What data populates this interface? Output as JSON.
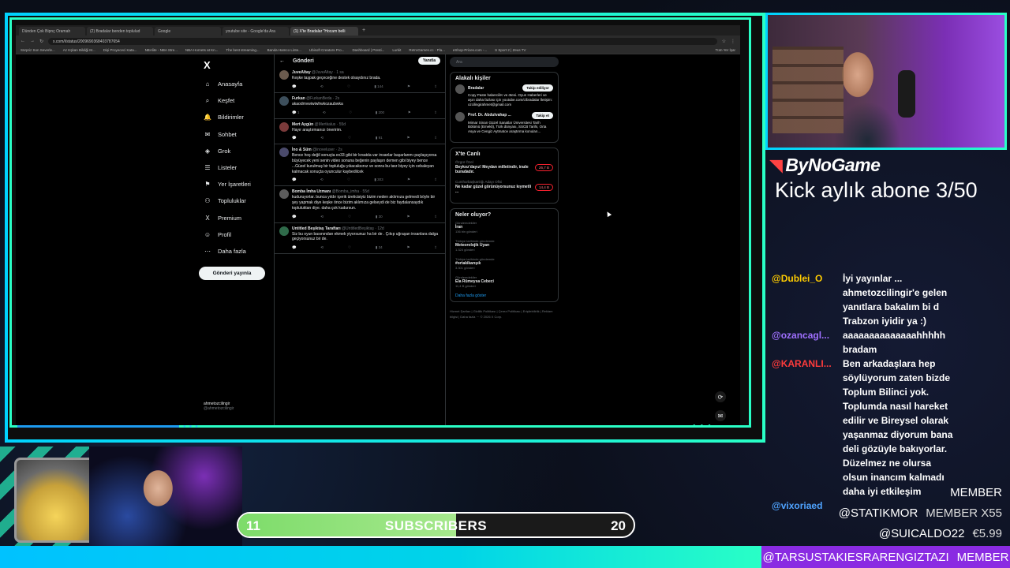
{
  "browser": {
    "tabs": [
      "Dünden Çok Bipnç Oramah",
      "(2) Bradalar benden toplulud",
      "Google",
      "youtube site - Google'da Ara",
      "(1) X'te Bradalar \"Hocam belli"
    ],
    "tab_new": "+",
    "url": "x.com/i/status/2009690368403787654",
    "bookmarks": [
      "Sürpriz Son Severle...",
      "Az Kşkan Bildiği M...",
      "Dişi Proyececi Kata...",
      "NBAlite - NBA Stre...",
      "NBA Hornets at Kn...",
      "The best streaming...",
      "Banda Hamco Linte...",
      "Ubisoft Creators Pro...",
      "Dashboard | Presti...",
      "Lurkit",
      "RetroGames.cc - Pla...",
      "eShop-Prices.com -...",
      "S Sport 2 | Zeus TV"
    ],
    "bookmarks_right": "Tüm Yer İşar"
  },
  "x": {
    "logo": "X",
    "nav": [
      {
        "icon": "⌂",
        "label": "Anasayfa"
      },
      {
        "icon": "⌕",
        "label": "Keşfet"
      },
      {
        "icon": "🔔",
        "label": "Bildirimler"
      },
      {
        "icon": "✉",
        "label": "Sohbet"
      },
      {
        "icon": "◈",
        "label": "Grok"
      },
      {
        "icon": "☰",
        "label": "Listeler"
      },
      {
        "icon": "⚑",
        "label": "Yer İşaretleri"
      },
      {
        "icon": "⚇",
        "label": "Topluluklar"
      },
      {
        "icon": "X",
        "label": "Premium"
      },
      {
        "icon": "☺",
        "label": "Profil"
      },
      {
        "icon": "⋯",
        "label": "Daha fazla"
      }
    ],
    "post_button": "Gönderi yayınla",
    "account": {
      "name": "ahmetozcilingir",
      "handle": "@ahmetozcilingir"
    },
    "header": {
      "back": "←",
      "title": "Gönderi",
      "reply": "Yanıtla"
    },
    "tweets": [
      {
        "name": "JuveAltay",
        "meta": "@JuveAltay · 1 sa",
        "text": "Keşke taşpak geçeceğine destek olsaydınız brada.",
        "stats": [
          "",
          "",
          "",
          "144"
        ]
      },
      {
        "name": "Furkan",
        "meta": "@FurkanBeda · 2s",
        "text": "akaodmvwiwiwhwkozaubwka",
        "stats": [
          "1",
          "",
          "",
          "200"
        ]
      },
      {
        "name": "Mert Aygün",
        "meta": "@Mertkalus · 55d",
        "text": "Hayır araştırmanızı öneririm.",
        "stats": [
          "",
          "",
          "",
          "91"
        ]
      },
      {
        "name": "İno & Süm",
        "meta": "@inoveluser · 2s",
        "text": "Bence hoş değil sonuçta ex33 gibi bir krsatda var insanlar başarlanmı paylaşıyorsa büyüyecek yeni senin video sonuna beğenin paylaşın demen gibi biyey bence ...Güzel kurulmuş bir topluluğu yıkacaksınız ve sonra bu tarz biyey için cebaleyan kalmacak sonuçta oyunculur kaybedilcek",
        "stats": [
          "",
          "",
          "",
          "303"
        ]
      },
      {
        "name": "Bomba İmha Uzmanı",
        "meta": "@Bomba_imha · 55d",
        "text": "kuduruyorlar. bunca yıldır içerik üreticisiyiz bizim neden aklımıza gelmedi böyle bir şey yapmak diye keşke önce bizim aklımıza gelseydi de biz faydalansaydık topluluktan diye. daha çok kudursun.",
        "stats": [
          "",
          "",
          "",
          "30"
        ]
      },
      {
        "name": "Untitled Beşiktaş Taraftarı",
        "meta": "@UntitledBeşiktaş · 12d",
        "text": "Siz bu oyun basınından ekmek yiyorsunuz ha bir de . Çıkıp uğraşan insanlara dalga geçiyorsunuz bir de.",
        "stats": [
          "",
          "",
          "",
          "34"
        ]
      }
    ],
    "search_placeholder": "Ara",
    "related": {
      "title": "Alakalı kişiler",
      "people": [
        {
          "name": "Bradalar",
          "bio": "Copy Paste haberciliK ve ötesi. Oyun Haberleri ve aşırı daha fazlası için youtube.com/c/bradalar İletişim: ozcilingirahmet@gmail.com",
          "button": "Takip ediliyor"
        },
        {
          "name": "Prof. Dr. Abdulvahap ...",
          "bio": "Mimar Sinan Güzel Sanatlar Üniversitesi Tarih Bölümü (Emekli), Türk dünyası, SSCB Tarihi, Orta Asya ve Cengiz Aytmatov araştırma konuları...",
          "button": "Takip et"
        }
      ]
    },
    "live": {
      "title": "X'te Canlı",
      "items": [
        {
          "host": "Özgür Özel",
          "text": "Beykoz'dayız! Meydan milletindir, irade buradadır.",
          "count": "26,7 B"
        },
        {
          "host": "Cumhurbaşkanlığı Adayı Ofisi",
          "text": "Ne kadar güzel görünüyorsunuz kıymetli ...",
          "count": "14,4 B"
        }
      ]
    },
    "trends": {
      "title": "Neler oluyor?",
      "items": [
        {
          "cat": "Gündemdekiler",
          "name": "İran",
          "count": "136 bin gönderi"
        },
        {
          "cat": "Türkiye tarihinde gündemde",
          "name": "Meteorolojik Uyarı",
          "count": "1.324 gönderi"
        },
        {
          "cat": "Türkiye tarihinde gündemde",
          "name": "#ortakikarışık",
          "count": "3.301 gönderi"
        },
        {
          "cat": "Gündemdekiler",
          "name": "Ela Rümeysa Cebeci",
          "count": "11,4 B gönderi"
        }
      ],
      "more": "Daha fazla göster"
    },
    "footer": "Hizmet Şartları | Gizlilik Politikası | Çerez Politikası | Erişilebilirlik | Reklam bilgisi | Daha fazla ··· © 2026 X Corp."
  },
  "overlay": {
    "brand": "ByNoGame",
    "kick_goal": "Kick aylık abone 3/50",
    "subscribers": {
      "label": "SUBSCRIBERS",
      "current": "11",
      "target": "20",
      "progress": 0.55
    },
    "chat": [
      {
        "user": "@Dublei_O",
        "user_color": "#ffcc00",
        "msg": "İyi yayınlar ... ahmetozcilingir'e gelen yanıtlara bakalım bi d"
      },
      {
        "user": "",
        "user_color": "#ffffff",
        "msg": "Trabzon iyidir ya :)"
      },
      {
        "user": "@ozancagl...",
        "user_color": "#a070ff",
        "msg": "aaaaaaaaaaaaaahhhhh bradam"
      },
      {
        "user": "@KARANLI...",
        "user_color": "#ff3b3b",
        "msg": "Ben arkadaşlara hep söylüyorum zaten bizde Toplum Bilinci yok. Toplumda nasıl hareket edilir ve Bireysel olarak yaşanmaz diyorum bana deli gözüyle bakıyorlar. Düzelmez ne olursa olsun inancım kalmadı daha iyi etkileşim"
      },
      {
        "user": "@vixoriaed",
        "user_color": "#4fa3ff",
        "msg": ""
      }
    ],
    "tickers": [
      {
        "name": "@STATIKMOR",
        "value": "MEMBER X55"
      },
      {
        "name": "@SUICALDO22",
        "value": "€5.99"
      }
    ],
    "ticker_bottom": {
      "name": "@TARSUSTAKIESRARENGIZTAZI",
      "value": "MEMBER"
    },
    "member_label": "MEMBER"
  }
}
